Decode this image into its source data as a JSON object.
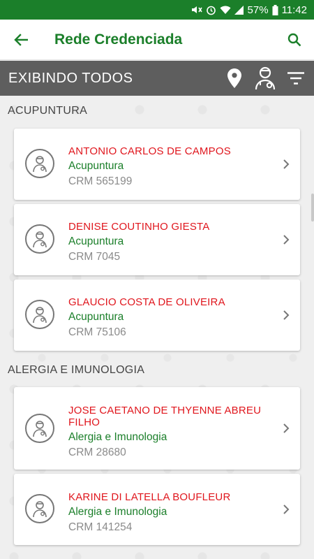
{
  "status_bar": {
    "battery": "57%",
    "time": "11:42"
  },
  "app_bar": {
    "title": "Rede Credenciada"
  },
  "filter_bar": {
    "label": "EXIBINDO TODOS"
  },
  "sections": [
    {
      "title": "ACUPUNTURA",
      "items": [
        {
          "name": "ANTONIO CARLOS DE CAMPOS",
          "specialty": "Acupuntura",
          "crm": "CRM 565199"
        },
        {
          "name": "DENISE COUTINHO GIESTA",
          "specialty": "Acupuntura",
          "crm": "CRM 7045"
        },
        {
          "name": "GLAUCIO COSTA DE OLIVEIRA",
          "specialty": "Acupuntura",
          "crm": "CRM 75106"
        }
      ]
    },
    {
      "title": "ALERGIA E IMUNOLOGIA",
      "items": [
        {
          "name": "JOSE CAETANO DE THYENNE ABREU FILHO",
          "specialty": "Alergia e Imunologia",
          "crm": "CRM 28680"
        },
        {
          "name": "KARINE DI LATELLA BOUFLEUR",
          "specialty": "Alergia e Imunologia",
          "crm": "CRM 141254"
        }
      ]
    }
  ],
  "colors": {
    "primary_green": "#1b7f2a",
    "name_red": "#e0161d",
    "filter_bar_gray": "#5e5e5e"
  }
}
